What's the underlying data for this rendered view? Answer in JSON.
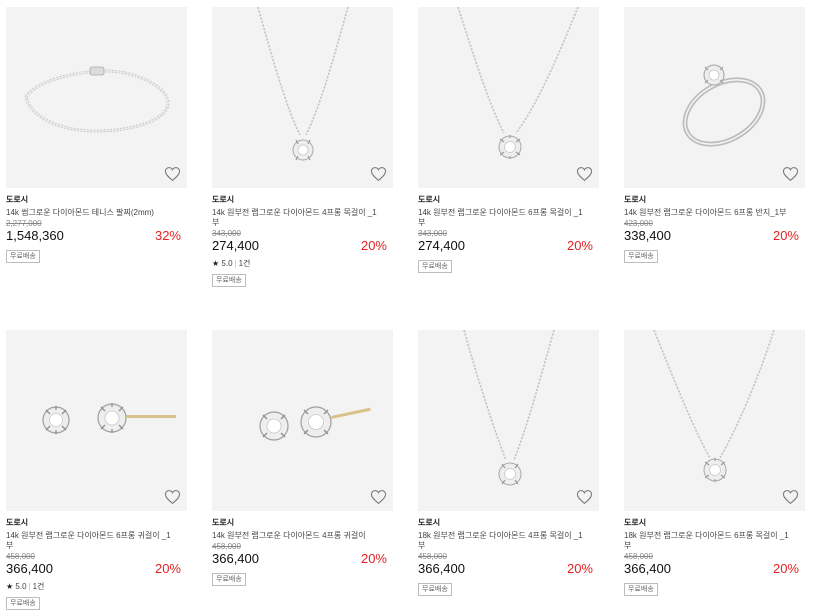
{
  "products": [
    {
      "brand": "도로시",
      "name": "14k 썸그로운 다이아몬드 테니스 팔찌(2mm)",
      "original_price": "2,277,000",
      "price": "1,548,360",
      "discount": "32%",
      "rating": null,
      "review_count": null,
      "badge": "무료배송",
      "image": "tennis-bracelet"
    },
    {
      "brand": "도로시",
      "name": "14k 원부전 랩그로운 다이아몬드 4프롱 목걸이 _1부",
      "original_price": "343,000",
      "price": "274,400",
      "discount": "20%",
      "rating": "5.0",
      "review_count": "1건",
      "badge": "무료배송",
      "image": "solitaire-necklace"
    },
    {
      "brand": "도로시",
      "name": "14k 원부전 랩그로운 다이아몬드 6프롱 목걸이 _1부",
      "original_price": "343,000",
      "price": "274,400",
      "discount": "20%",
      "rating": null,
      "review_count": null,
      "badge": "무료배송",
      "image": "solitaire-necklace"
    },
    {
      "brand": "도로시",
      "name": "14k 원부전 랩그로운 다이아몬드 6프롱 반지_1부",
      "original_price": "423,000",
      "price": "338,400",
      "discount": "20%",
      "rating": null,
      "review_count": null,
      "badge": "무료배송",
      "image": "solitaire-ring"
    },
    {
      "brand": "도로시",
      "name": "14k 원부전 랩그로운 다이아몬드 6프롱 귀걸이 _1부",
      "original_price": "458,000",
      "price": "366,400",
      "discount": "20%",
      "rating": "5.0",
      "review_count": "1건",
      "badge": "무료배송",
      "image": "stud-earrings"
    },
    {
      "brand": "도로시",
      "name": "14k 원부전 랩그로운 다이아몬드 4프롱 귀걸이",
      "original_price": "458,000",
      "price": "366,400",
      "discount": "20%",
      "rating": null,
      "review_count": null,
      "badge": "무료배송",
      "image": "stud-earrings"
    },
    {
      "brand": "도로시",
      "name": "18k 원부전 랩그로운 다이아몬드 4프롱 목걸이 _1부",
      "original_price": "458,000",
      "price": "366,400",
      "discount": "20%",
      "rating": null,
      "review_count": null,
      "badge": "무료배송",
      "image": "solitaire-necklace"
    },
    {
      "brand": "도로시",
      "name": "18k 원부전 랩그로운 다이아몬드 6프롱 목걸이 _1부",
      "original_price": "458,000",
      "price": "366,400",
      "discount": "20%",
      "rating": null,
      "review_count": null,
      "badge": "무료배송",
      "image": "solitaire-necklace"
    }
  ],
  "colors": {
    "discount": "#e52222",
    "thumb_bg": "#f3f3f3"
  },
  "icons": {
    "wishlist": "heart-outline-icon",
    "rating": "star-icon"
  }
}
